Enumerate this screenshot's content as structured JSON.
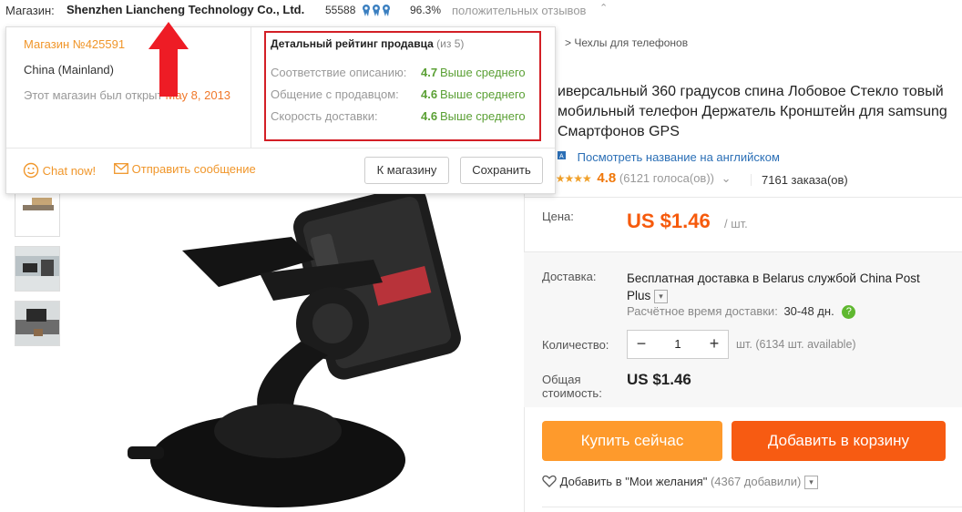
{
  "store_bar": {
    "label": "Магазин:",
    "name": "Shenzhen Liancheng Technology Co., Ltd.",
    "score": "55588",
    "positive_percent": "96.3%",
    "positive_label": "положительных отзывов",
    "chevron": "⌃"
  },
  "popup": {
    "store_number": "Магазин №425591",
    "country": "China (Mainland)",
    "opened_label": "Этот магазин был открыт",
    "opened_date": "May 8, 2013",
    "rating_title": "Детальный рейтинг продавца",
    "rating_scale": "(из 5)",
    "ratings": [
      {
        "label": "Соответствие описанию:",
        "value": "4.7",
        "text": "Выше среднего"
      },
      {
        "label": "Общение с продавцом:",
        "value": "4.6",
        "text": "Выше среднего"
      },
      {
        "label": "Скорость доставки:",
        "value": "4.6",
        "text": "Выше среднего"
      }
    ],
    "chat_label": "Chat now!",
    "message_label": "Отправить сообщение",
    "store_button": "К магазину",
    "save_button": "Сохранить"
  },
  "product": {
    "breadcrumb_sep": ">",
    "breadcrumb": "Чехлы для телефонов",
    "title": "иверсальный 360 градусов спина Лобовое Стекло товый мобильный телефон Держатель Кронштейн для samsung Смартфонов GPS",
    "english_link": "Посмотреть название на английском",
    "stars": "★★★★★",
    "rating": "4.8",
    "votes": "(6121 голоса(ов))",
    "votes_chevron": "⌄",
    "orders": "7161 заказа(ов)",
    "price_label": "Цена:",
    "price": "US $1.46",
    "price_unit": "/ шт.",
    "shipping_label": "Доставка:",
    "shipping_text": "Бесплатная доставка в Belarus службой China Post Plus",
    "eta_label": "Расчётное время доставки:",
    "eta_value": "30-48 дн.",
    "quantity_label": "Количество:",
    "quantity_minus": "−",
    "quantity": "1",
    "quantity_plus": "+",
    "quantity_available": "шт. (6134 шт. available)",
    "total_label_1": "Общая",
    "total_label_2": "стоимость:",
    "total": "US $1.46",
    "buy_now": "Купить сейчас",
    "add_to_cart": "Добавить в корзину",
    "wishlist": "Добавить в \"Мои желания\"",
    "wishlist_count": "(4367 добавили)"
  },
  "colors": {
    "accent_orange": "#f65a0c",
    "buy_now": "#fe9a2c",
    "add_cart": "#f75b12",
    "rating_green": "#5ba035",
    "highlight_red": "#d31f26"
  }
}
